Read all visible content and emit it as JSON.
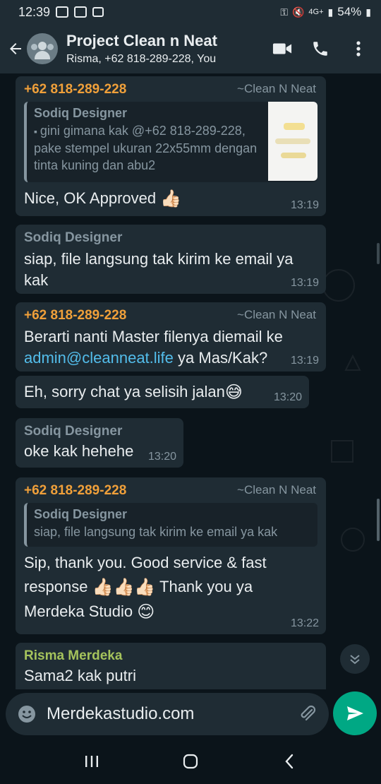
{
  "status_bar": {
    "time": "12:39",
    "battery": "54%",
    "network": "4G+",
    "icons": [
      "gallery-icon",
      "image-icon",
      "dh-icon",
      "key-icon",
      "mute-icon",
      "signal-icon",
      "battery-icon"
    ]
  },
  "header": {
    "title": "Project Clean n Neat",
    "subtitle": "Risma, +62 818-289-228, You",
    "icons": [
      "back-arrow-icon",
      "group-avatar-icon",
      "video-call-icon",
      "voice-call-icon",
      "more-options-icon"
    ]
  },
  "messages": [
    {
      "sender": "+62 818-289-228",
      "pushname": "~Clean N Neat",
      "quote_sender": "Sodiq Designer",
      "quote_text": "gini gimana kak @+62 818-289-228, pake stempel ukuran 22x55mm dengan tinta kuning dan abu2",
      "text": "Nice, OK Approved",
      "emoji": "👍🏻",
      "time": "13:19"
    },
    {
      "sender": "Sodiq Designer",
      "text": "siap, file langsung tak kirim ke email ya kak",
      "time": "13:19"
    },
    {
      "sender": "+62 818-289-228",
      "pushname": "~Clean N Neat",
      "text_before": "Berarti nanti Master filenya diemail ke",
      "link": "admin@cleanneat.life",
      "text_after": "ya Mas/Kak?",
      "time": "13:19"
    },
    {
      "text": "Eh, sorry chat ya selisih jalan",
      "emoji": "😅",
      "time": "13:20"
    },
    {
      "sender": "Sodiq Designer",
      "text": "oke kak hehehe",
      "time": "13:20"
    },
    {
      "sender": "+62 818-289-228",
      "pushname": "~Clean N Neat",
      "quote_sender": "Sodiq Designer",
      "quote_text": "siap, file langsung tak kirim ke email ya kak",
      "line1": "Sip, thank you. Good service & fast",
      "line2_a": "response",
      "line2_emoji": "👍🏻👍🏻👍🏻",
      "line2_b": "Thank you ya",
      "line3": "Merdeka Studio",
      "line3_emoji": "😊",
      "time": "13:22"
    },
    {
      "sender": "Risma Merdeka",
      "text": "Sama2 kak putri"
    }
  ],
  "input": {
    "value": "Merdekastudio.com",
    "icons": [
      "emoji-icon",
      "attach-icon",
      "send-icon"
    ]
  },
  "nav": {
    "icons": [
      "recent-apps-icon",
      "home-icon",
      "back-icon"
    ]
  },
  "colors": {
    "background": "#0b141a",
    "bubble": "#1f2c34",
    "accent": "#00a884",
    "sender_orange": "#f0a03a",
    "sender_green": "#a5c35c",
    "link": "#53bdeb"
  }
}
